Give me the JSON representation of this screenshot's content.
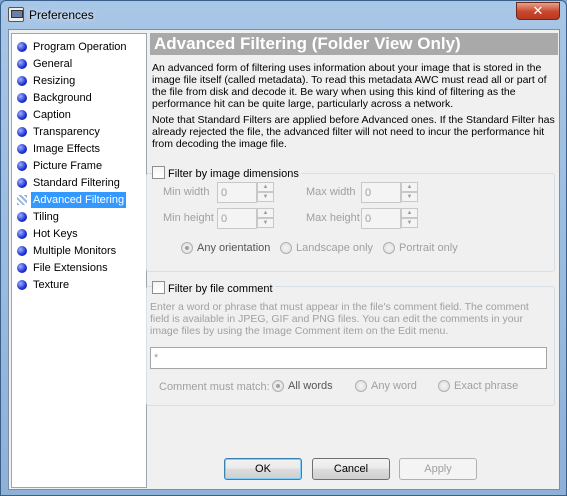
{
  "window": {
    "title": "Preferences",
    "close_glyph": "✕"
  },
  "sidebar": {
    "items": [
      {
        "label": "Program Operation"
      },
      {
        "label": "General"
      },
      {
        "label": "Resizing"
      },
      {
        "label": "Background"
      },
      {
        "label": "Caption"
      },
      {
        "label": "Transparency"
      },
      {
        "label": "Image Effects"
      },
      {
        "label": "Picture Frame"
      },
      {
        "label": "Standard Filtering"
      },
      {
        "label": "Advanced Filtering",
        "selected": true
      },
      {
        "label": "Tiling"
      },
      {
        "label": "Hot Keys"
      },
      {
        "label": "Multiple Monitors"
      },
      {
        "label": "File Extensions"
      },
      {
        "label": "Texture"
      }
    ]
  },
  "main": {
    "heading": "Advanced Filtering (Folder View Only)",
    "intro": "An advanced form of filtering uses information about your image that is stored in the image file itself (called metadata). To read this metadata AWC must read all or part of the file from disk and decode it. Be wary when using this kind of filtering as the performance hit can be quite large, particularly across a network.",
    "note": "Note that Standard Filters are applied before Advanced ones. If the Standard Filter has already rejected the file, the advanced filter will not need to incur the performance hit from decoding the image file.",
    "dimensions": {
      "checkbox_label": "Filter by image dimensions",
      "checked": false,
      "min_width_label": "Min width",
      "min_width_value": "0",
      "max_width_label": "Max width",
      "max_width_value": "0",
      "min_height_label": "Min height",
      "min_height_value": "0",
      "max_height_label": "Max height",
      "max_height_value": "0",
      "orientation_options": [
        "Any orientation",
        "Landscape only",
        "Portrait only"
      ],
      "orientation_selected": "Any orientation"
    },
    "comment": {
      "checkbox_label": "Filter by file comment",
      "checked": false,
      "description": "Enter a word or phrase that must appear in the file's comment field. The comment field is available in JPEG, GIF and PNG files. You can edit the comments in your image files by using the Image Comment item on the Edit menu.",
      "input_value": "*",
      "match_label": "Comment must match:",
      "match_options": [
        "All words",
        "Any word",
        "Exact phrase"
      ],
      "match_selected": "All words"
    }
  },
  "buttons": {
    "ok": "OK",
    "cancel": "Cancel",
    "apply": "Apply"
  }
}
